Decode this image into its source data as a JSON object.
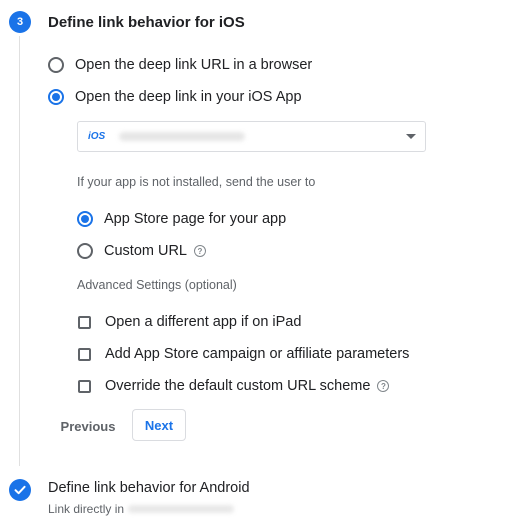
{
  "step3": {
    "number": "3",
    "title": "Define link behavior for iOS",
    "options": [
      {
        "label": "Open the deep link URL in a browser",
        "selected": false
      },
      {
        "label": "Open the deep link in your iOS App",
        "selected": true
      }
    ],
    "app_select": {
      "platform_tag": "iOS",
      "selected_app": ""
    },
    "not_installed_label": "If your app is not installed, send the user to",
    "fallback_options": [
      {
        "label": "App Store page for your app",
        "selected": true
      },
      {
        "label": "Custom URL",
        "selected": false,
        "help_icon": "help-circle-icon"
      }
    ],
    "advanced_label": "Advanced Settings (optional)",
    "advanced_options": [
      {
        "label": "Open a different app if on iPad",
        "checked": false
      },
      {
        "label": "Add App Store campaign or affiliate parameters",
        "checked": false
      },
      {
        "label": "Override the default custom URL scheme",
        "checked": false,
        "help_icon": "help-circle-icon"
      }
    ],
    "buttons": {
      "previous": "Previous",
      "next": "Next"
    }
  },
  "step_android": {
    "title": "Define link behavior for Android",
    "subtitle": "Link directly in",
    "status_icon": "check-icon"
  },
  "colors": {
    "accent": "#1a73e8",
    "text": "#202124",
    "muted": "#5f6368",
    "border": "#dadce0"
  },
  "help_glyph": "?"
}
